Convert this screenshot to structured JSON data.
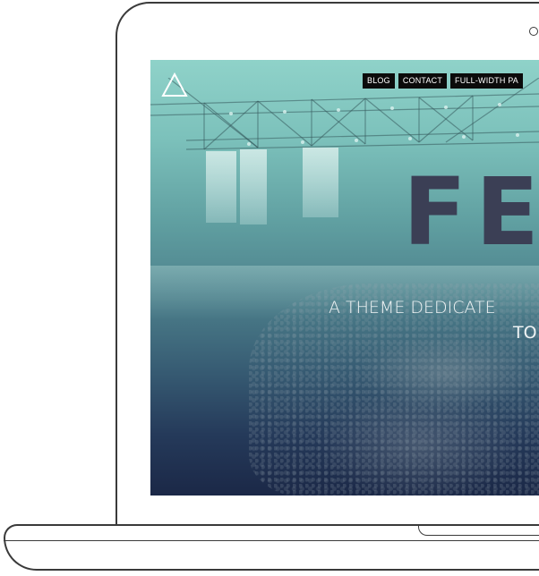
{
  "site": {
    "logo_icon": "triangle-outline-icon"
  },
  "nav": {
    "items": [
      {
        "label": "BLOG"
      },
      {
        "label": "CONTACT"
      },
      {
        "label": "FULL-WIDTH PA"
      }
    ]
  },
  "hero": {
    "title": "FE",
    "line1": "A THEME DEDICATE",
    "line2": "TO"
  },
  "colors": {
    "nav_background": "#0b0b0b",
    "nav_text": "#ffffff",
    "hero_title": "#3b3f55",
    "hero_text": "#eef3f4",
    "laptop_outline": "#3a3a3a"
  }
}
